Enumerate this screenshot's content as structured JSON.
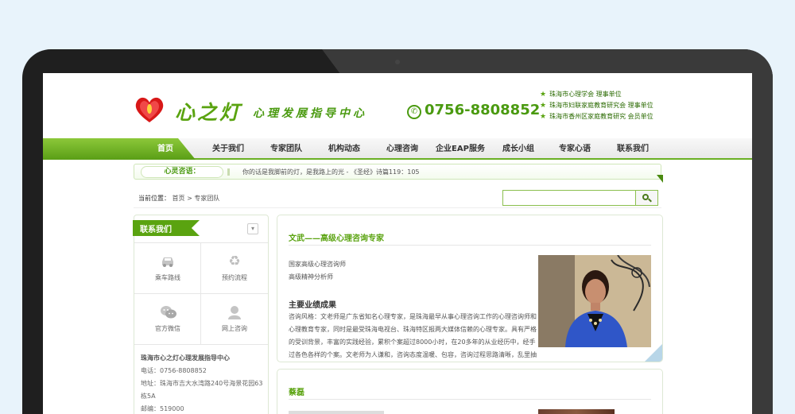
{
  "header": {
    "logo_title": "心之灯",
    "logo_subtitle": "心理发展指导中心",
    "phone": "0756-8808852",
    "orgs": [
      "珠海市心理学会 理事单位",
      "珠海市妇联家庭教育研究会 理事单位",
      "珠海市香州区家庭教育研究 会员单位"
    ]
  },
  "nav": {
    "items": [
      "首页",
      "关于我们",
      "专家团队",
      "机构动态",
      "心理咨询",
      "企业EAP服务",
      "成长小组",
      "专家心语",
      "联系我们"
    ],
    "active_index": 0
  },
  "quote": {
    "label": "心灵咨语：",
    "text": "你的话是我脚前的灯，是我路上的光 - 《圣经》诗篇119：105"
  },
  "breadcrumb": {
    "label": "当前位置：",
    "path": "首页 > 专家团队"
  },
  "search": {
    "value": ""
  },
  "sidebar": {
    "title": "联系我们",
    "tiles": [
      {
        "label": "乘车路线",
        "icon": "car-icon"
      },
      {
        "label": "预约流程",
        "icon": "recycle-icon"
      },
      {
        "label": "官方微信",
        "icon": "wechat-icon"
      },
      {
        "label": "网上咨询",
        "icon": "user-icon"
      }
    ],
    "info": {
      "org_name": "珠海市心之灯心理发展指导中心",
      "phone": "电话：0756-8808852",
      "address": "地址：珠海市吉大水湾路240号海景花园63栋5A",
      "postcode": "邮编：519000"
    }
  },
  "experts": [
    {
      "name": "文武——高级心理咨询专家",
      "titles": [
        "国家高级心理咨询师",
        "高级精神分析师"
      ],
      "section": "主要业绩成果",
      "paragraph": "咨询风格：文老师是广东省知名心理专家，是珠海最早从事心理咨询工作的心理咨询师和心理教育专家，同时是最受珠海电视台、珠海特区报两大媒体信赖的心理专家。具有严格的受训背景，丰富的实践经验，累积个案超过8000小时，在20多年的从业经历中，经手过各色各样的个案。文老师为人谦和，咨询态度温暖、包容，咨询过程思路清晰，乱里抽"
    },
    {
      "name": "蔡磊"
    }
  ]
}
